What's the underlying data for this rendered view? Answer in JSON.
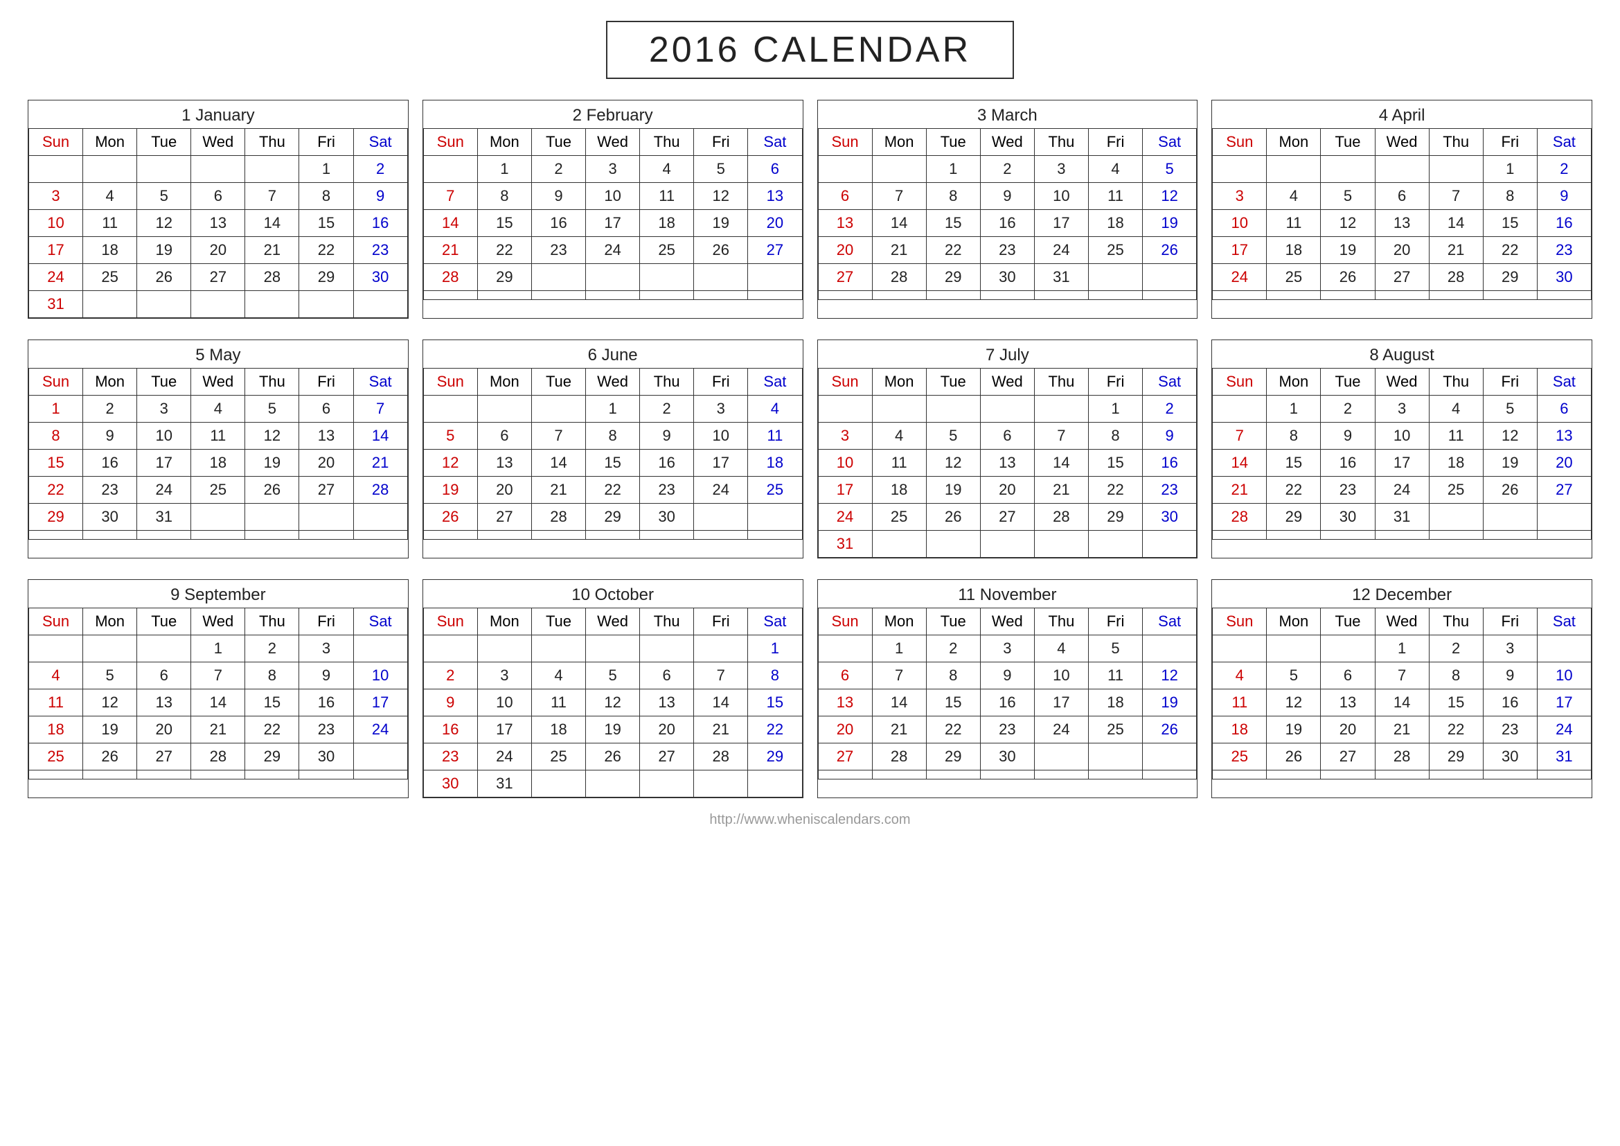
{
  "title": "2016 CALENDAR",
  "footer": "http://www.wheniscalendars.com",
  "months": [
    {
      "number": "1",
      "name": "January",
      "weeks": [
        [
          "",
          "",
          "",
          "",
          "",
          "1",
          "2"
        ],
        [
          "3",
          "4",
          "5",
          "6",
          "7",
          "8",
          "9"
        ],
        [
          "10",
          "11",
          "12",
          "13",
          "14",
          "15",
          "16"
        ],
        [
          "17",
          "18",
          "19",
          "20",
          "21",
          "22",
          "23"
        ],
        [
          "24",
          "25",
          "26",
          "27",
          "28",
          "29",
          "30"
        ],
        [
          "31",
          "",
          "",
          "",
          "",
          "",
          ""
        ]
      ]
    },
    {
      "number": "2",
      "name": "February",
      "weeks": [
        [
          "",
          "1",
          "2",
          "3",
          "4",
          "5",
          "6"
        ],
        [
          "7",
          "8",
          "9",
          "10",
          "11",
          "12",
          "13"
        ],
        [
          "14",
          "15",
          "16",
          "17",
          "18",
          "19",
          "20"
        ],
        [
          "21",
          "22",
          "23",
          "24",
          "25",
          "26",
          "27"
        ],
        [
          "28",
          "29",
          "",
          "",
          "",
          "",
          ""
        ],
        [
          "",
          "",
          "",
          "",
          "",
          "",
          ""
        ]
      ]
    },
    {
      "number": "3",
      "name": "March",
      "weeks": [
        [
          "",
          "",
          "1",
          "2",
          "3",
          "4",
          "5"
        ],
        [
          "6",
          "7",
          "8",
          "9",
          "10",
          "11",
          "12"
        ],
        [
          "13",
          "14",
          "15",
          "16",
          "17",
          "18",
          "19"
        ],
        [
          "20",
          "21",
          "22",
          "23",
          "24",
          "25",
          "26"
        ],
        [
          "27",
          "28",
          "29",
          "30",
          "31",
          "",
          ""
        ],
        [
          "",
          "",
          "",
          "",
          "",
          "",
          ""
        ]
      ]
    },
    {
      "number": "4",
      "name": "April",
      "weeks": [
        [
          "",
          "",
          "",
          "",
          "",
          "1",
          "2"
        ],
        [
          "3",
          "4",
          "5",
          "6",
          "7",
          "8",
          "9"
        ],
        [
          "10",
          "11",
          "12",
          "13",
          "14",
          "15",
          "16"
        ],
        [
          "17",
          "18",
          "19",
          "20",
          "21",
          "22",
          "23"
        ],
        [
          "24",
          "25",
          "26",
          "27",
          "28",
          "29",
          "30"
        ],
        [
          "",
          "",
          "",
          "",
          "",
          "",
          ""
        ]
      ]
    },
    {
      "number": "5",
      "name": "May",
      "weeks": [
        [
          "1",
          "2",
          "3",
          "4",
          "5",
          "6",
          "7"
        ],
        [
          "8",
          "9",
          "10",
          "11",
          "12",
          "13",
          "14"
        ],
        [
          "15",
          "16",
          "17",
          "18",
          "19",
          "20",
          "21"
        ],
        [
          "22",
          "23",
          "24",
          "25",
          "26",
          "27",
          "28"
        ],
        [
          "29",
          "30",
          "31",
          "",
          "",
          "",
          ""
        ],
        [
          "",
          "",
          "",
          "",
          "",
          "",
          ""
        ]
      ]
    },
    {
      "number": "6",
      "name": "June",
      "weeks": [
        [
          "",
          "",
          "",
          "1",
          "2",
          "3",
          "4"
        ],
        [
          "5",
          "6",
          "7",
          "8",
          "9",
          "10",
          "11"
        ],
        [
          "12",
          "13",
          "14",
          "15",
          "16",
          "17",
          "18"
        ],
        [
          "19",
          "20",
          "21",
          "22",
          "23",
          "24",
          "25"
        ],
        [
          "26",
          "27",
          "28",
          "29",
          "30",
          "",
          ""
        ],
        [
          "",
          "",
          "",
          "",
          "",
          "",
          ""
        ]
      ]
    },
    {
      "number": "7",
      "name": "July",
      "weeks": [
        [
          "",
          "",
          "",
          "",
          "",
          "1",
          "2"
        ],
        [
          "3",
          "4",
          "5",
          "6",
          "7",
          "8",
          "9"
        ],
        [
          "10",
          "11",
          "12",
          "13",
          "14",
          "15",
          "16"
        ],
        [
          "17",
          "18",
          "19",
          "20",
          "21",
          "22",
          "23"
        ],
        [
          "24",
          "25",
          "26",
          "27",
          "28",
          "29",
          "30"
        ],
        [
          "31",
          "",
          "",
          "",
          "",
          "",
          ""
        ]
      ]
    },
    {
      "number": "8",
      "name": "August",
      "weeks": [
        [
          "",
          "1",
          "2",
          "3",
          "4",
          "5",
          "6"
        ],
        [
          "7",
          "8",
          "9",
          "10",
          "11",
          "12",
          "13"
        ],
        [
          "14",
          "15",
          "16",
          "17",
          "18",
          "19",
          "20"
        ],
        [
          "21",
          "22",
          "23",
          "24",
          "25",
          "26",
          "27"
        ],
        [
          "28",
          "29",
          "30",
          "31",
          "",
          "",
          ""
        ],
        [
          "",
          "",
          "",
          "",
          "",
          "",
          ""
        ]
      ]
    },
    {
      "number": "9",
      "name": "September",
      "weeks": [
        [
          "",
          "",
          "",
          "1",
          "2",
          "3",
          ""
        ],
        [
          "4",
          "5",
          "6",
          "7",
          "8",
          "9",
          "10"
        ],
        [
          "11",
          "12",
          "13",
          "14",
          "15",
          "16",
          "17"
        ],
        [
          "18",
          "19",
          "20",
          "21",
          "22",
          "23",
          "24"
        ],
        [
          "25",
          "26",
          "27",
          "28",
          "29",
          "30",
          ""
        ],
        [
          "",
          "",
          "",
          "",
          "",
          "",
          ""
        ]
      ]
    },
    {
      "number": "10",
      "name": "October",
      "weeks": [
        [
          "",
          "",
          "",
          "",
          "",
          "",
          "1"
        ],
        [
          "2",
          "3",
          "4",
          "5",
          "6",
          "7",
          "8"
        ],
        [
          "9",
          "10",
          "11",
          "12",
          "13",
          "14",
          "15"
        ],
        [
          "16",
          "17",
          "18",
          "19",
          "20",
          "21",
          "22"
        ],
        [
          "23",
          "24",
          "25",
          "26",
          "27",
          "28",
          "29"
        ],
        [
          "30",
          "31",
          "",
          "",
          "",
          "",
          ""
        ]
      ]
    },
    {
      "number": "11",
      "name": "November",
      "weeks": [
        [
          "",
          "1",
          "2",
          "3",
          "4",
          "5",
          ""
        ],
        [
          "6",
          "7",
          "8",
          "9",
          "10",
          "11",
          "12"
        ],
        [
          "13",
          "14",
          "15",
          "16",
          "17",
          "18",
          "19"
        ],
        [
          "20",
          "21",
          "22",
          "23",
          "24",
          "25",
          "26"
        ],
        [
          "27",
          "28",
          "29",
          "30",
          "",
          "",
          ""
        ],
        [
          "",
          "",
          "",
          "",
          "",
          "",
          ""
        ]
      ]
    },
    {
      "number": "12",
      "name": "December",
      "weeks": [
        [
          "",
          "",
          "",
          "1",
          "2",
          "3",
          ""
        ],
        [
          "4",
          "5",
          "6",
          "7",
          "8",
          "9",
          "10"
        ],
        [
          "11",
          "12",
          "13",
          "14",
          "15",
          "16",
          "17"
        ],
        [
          "18",
          "19",
          "20",
          "21",
          "22",
          "23",
          "24"
        ],
        [
          "25",
          "26",
          "27",
          "28",
          "29",
          "30",
          "31"
        ],
        [
          "",
          "",
          "",
          "",
          "",
          "",
          ""
        ]
      ]
    }
  ],
  "days": [
    "Sun",
    "Mon",
    "Tue",
    "Wed",
    "Thu",
    "Fri",
    "Sat"
  ]
}
